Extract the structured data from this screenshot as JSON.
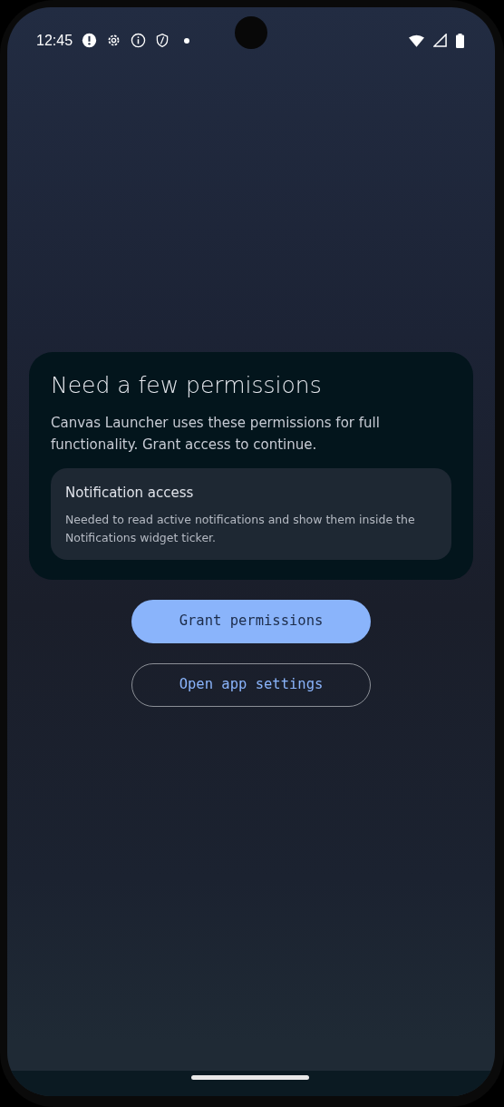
{
  "status_bar": {
    "time": "12:45"
  },
  "dialog": {
    "title": "Need a few permissions",
    "message": "Canvas Launcher uses these permissions for full functionality. Grant access to continue.",
    "permissions": [
      {
        "name": "Notification access",
        "description": "Needed to read active notifications and show them inside the Notifications widget ticker."
      }
    ]
  },
  "buttons": [
    {
      "label": "Grant permissions",
      "kind": "filled"
    },
    {
      "label": "Open app settings",
      "kind": "outlined"
    }
  ]
}
